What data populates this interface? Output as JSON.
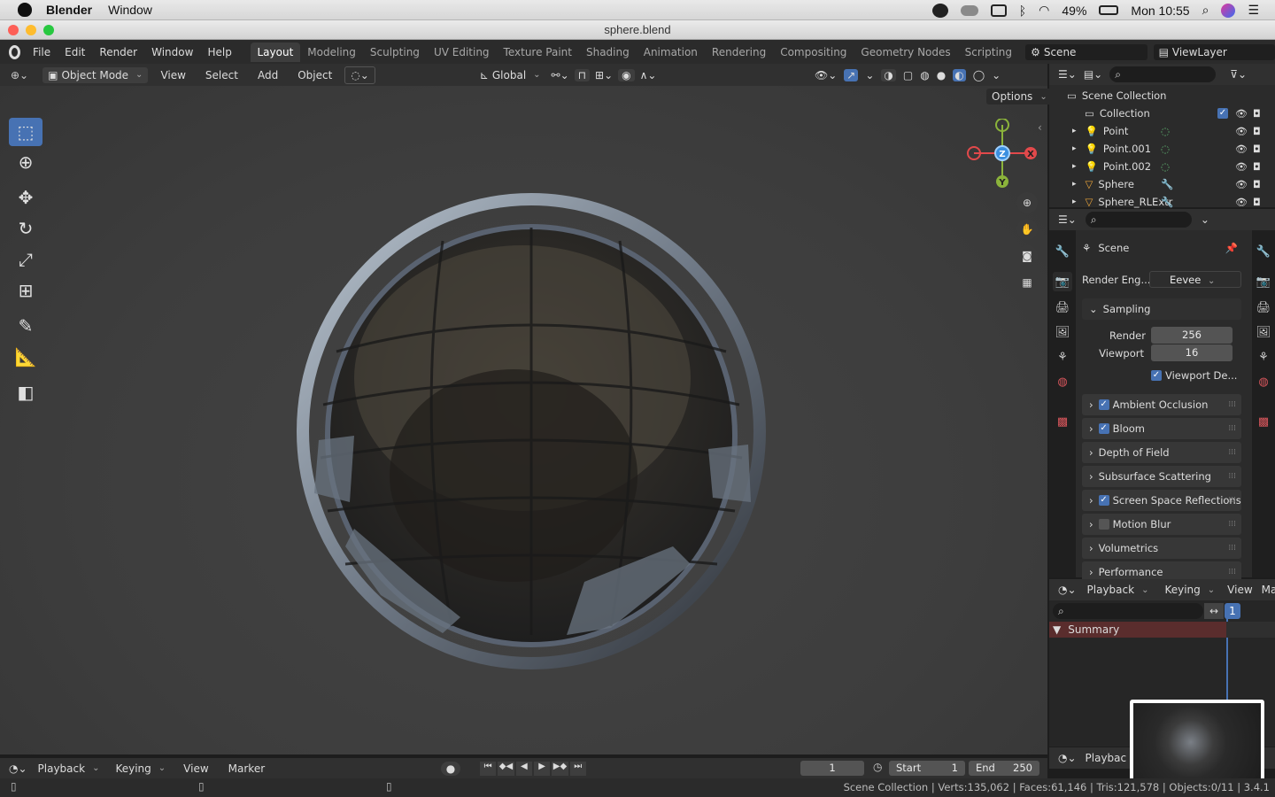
{
  "macbar": {
    "app_name": "Blender",
    "menu_window": "Window",
    "battery": "49%",
    "clock": "Mon 10:55"
  },
  "window": {
    "title": "sphere.blend"
  },
  "topbar": {
    "menus": [
      "File",
      "Edit",
      "Render",
      "Window",
      "Help"
    ],
    "workspaces": [
      "Layout",
      "Modeling",
      "Sculpting",
      "UV Editing",
      "Texture Paint",
      "Shading",
      "Animation",
      "Rendering",
      "Compositing",
      "Geometry Nodes",
      "Scripting"
    ],
    "active_workspace": "Layout",
    "scene": "Scene",
    "view_layer": "ViewLayer"
  },
  "viewport_header": {
    "mode": "Object Mode",
    "menus": [
      "View",
      "Select",
      "Add",
      "Object"
    ],
    "transform_orientation": "Global",
    "options": "Options"
  },
  "outliner": {
    "root": "Scene Collection",
    "collection": "Collection",
    "items": [
      {
        "name": "Point",
        "icon": "light-icon"
      },
      {
        "name": "Point.001",
        "icon": "light-icon"
      },
      {
        "name": "Point.002",
        "icon": "light-icon"
      },
      {
        "name": "Sphere",
        "icon": "mesh-icon"
      },
      {
        "name": "Sphere_RLExtr",
        "icon": "mesh-icon"
      }
    ]
  },
  "properties": {
    "context": "Scene",
    "render_engine_label": "Render Eng...",
    "render_engine": "Eevee",
    "sampling_label": "Sampling",
    "render_label": "Render",
    "render_samples": "256",
    "viewport_label": "Viewport",
    "viewport_samples": "16",
    "viewport_denoise": "Viewport De...",
    "sections": [
      {
        "label": "Ambient Occlusion",
        "checkbox": true,
        "checked": true
      },
      {
        "label": "Bloom",
        "checkbox": true,
        "checked": true
      },
      {
        "label": "Depth of Field",
        "checkbox": false,
        "checked": false
      },
      {
        "label": "Subsurface Scattering",
        "checkbox": false,
        "checked": false
      },
      {
        "label": "Screen Space Reflections",
        "checkbox": true,
        "checked": true
      },
      {
        "label": "Motion Blur",
        "checkbox": true,
        "checked": false
      },
      {
        "label": "Volumetrics",
        "checkbox": false,
        "checked": false
      },
      {
        "label": "Performance",
        "checkbox": false,
        "checked": false
      }
    ]
  },
  "dopesheet": {
    "menus": [
      "Playback",
      "Keying",
      "View",
      "Marker"
    ],
    "summary": "Summary",
    "frame_marker": "1",
    "playback_short": "Playbac"
  },
  "timeline": {
    "menus": [
      "Playback",
      "Keying",
      "View",
      "Marker"
    ],
    "current_frame": "1",
    "start_label": "Start",
    "start": "1",
    "end_label": "End",
    "end": "250"
  },
  "statusbar": {
    "text": "Scene Collection | Verts:135,062 | Faces:61,146 | Tris:121,578 | Objects:0/11 | 3.4.1"
  },
  "gizmo": {
    "x": "X",
    "y": "Y",
    "z": "Z"
  },
  "colors": {
    "accent": "#4772b3",
    "x_axis": "#e2494b",
    "y_axis": "#8bb33b",
    "z_axis": "#3b8fe0",
    "summary_bg": "#5a2d2d"
  }
}
